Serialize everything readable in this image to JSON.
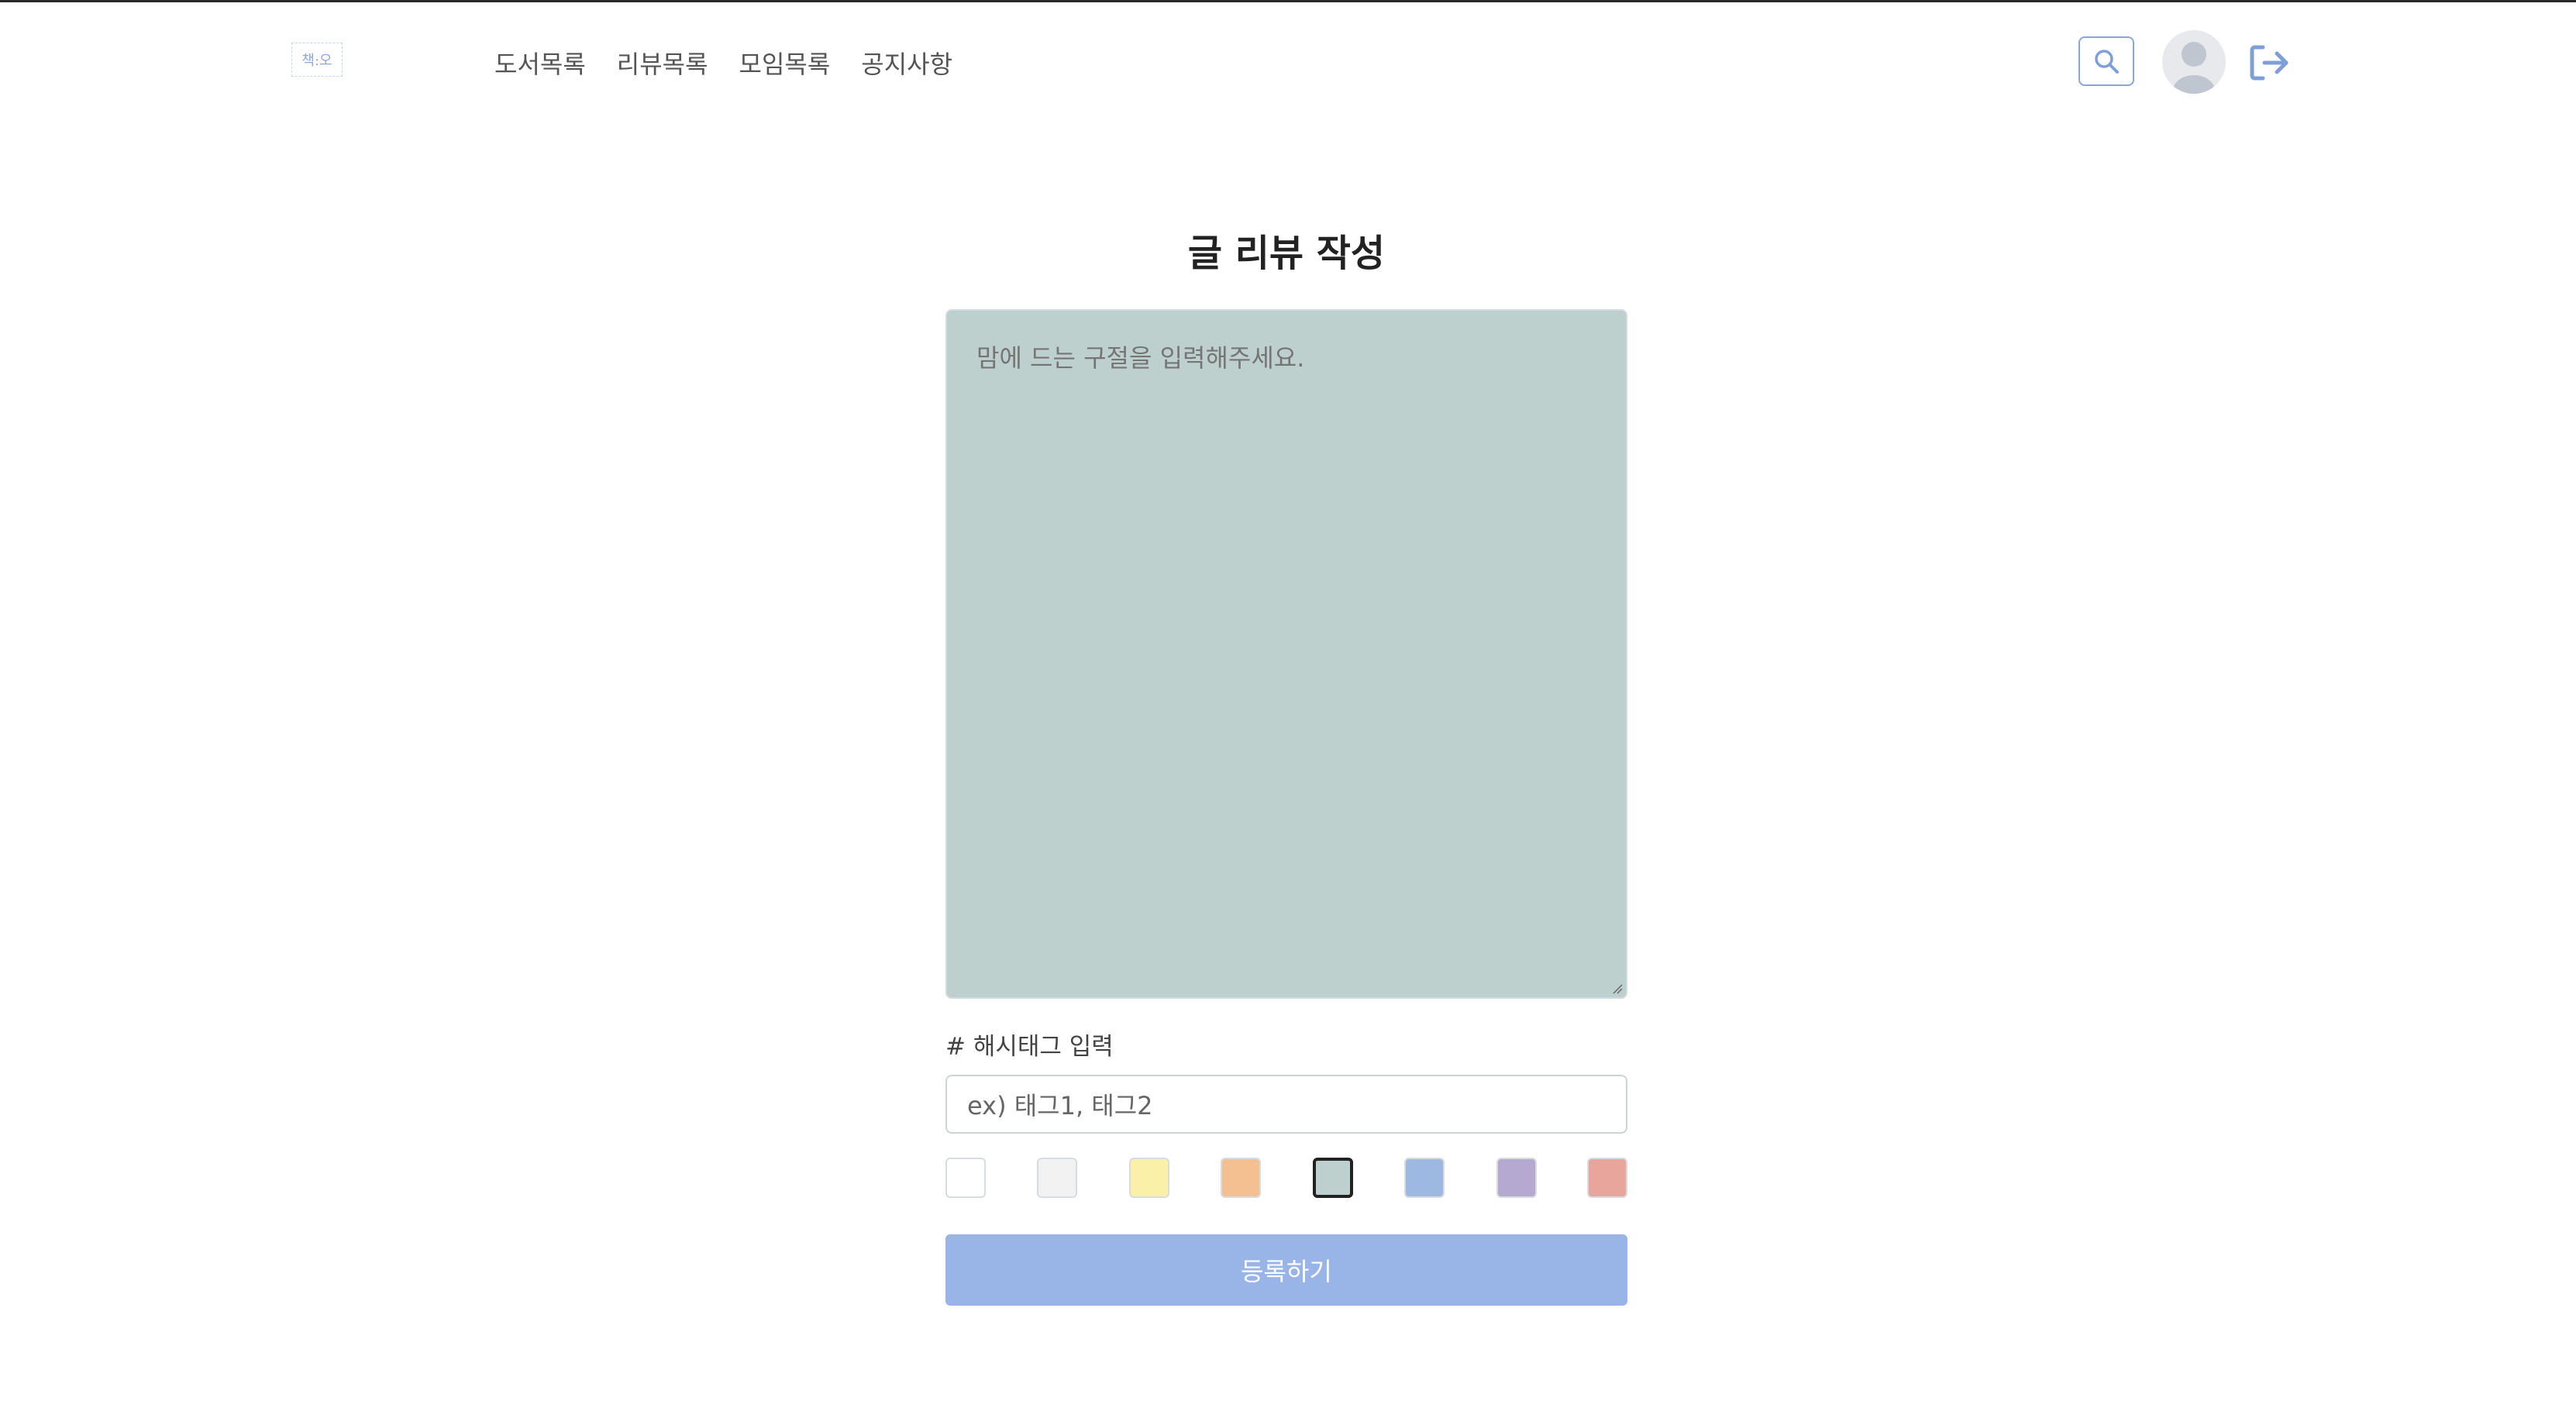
{
  "header": {
    "logo_text": "책:오",
    "nav": [
      "도서목록",
      "리뷰목록",
      "모임목록",
      "공지사항"
    ],
    "icons": {
      "search": "search-icon",
      "avatar": "user-avatar-icon",
      "logout": "logout-icon"
    },
    "accent_color": "#7f9fd9"
  },
  "main": {
    "title": "글 리뷰 작성",
    "quote_placeholder": "맘에 드는 구절을 입력해주세요.",
    "quote_value": "",
    "hashtag_label": "# 해시태그 입력",
    "hashtag_placeholder": "ex) 태그1, 태그2",
    "hashtag_value": "",
    "colors": [
      {
        "name": "white",
        "hex": "#ffffff",
        "selected": false
      },
      {
        "name": "light-gray",
        "hex": "#f2f2f2",
        "selected": false
      },
      {
        "name": "yellow",
        "hex": "#fbf0a8",
        "selected": false
      },
      {
        "name": "orange",
        "hex": "#f4c092",
        "selected": false
      },
      {
        "name": "sage",
        "hex": "#bdd0cd",
        "selected": true
      },
      {
        "name": "blue",
        "hex": "#9db9e2",
        "selected": false
      },
      {
        "name": "purple",
        "hex": "#b5a9d2",
        "selected": false
      },
      {
        "name": "pink",
        "hex": "#e8a59b",
        "selected": false
      }
    ],
    "submit_label": "등록하기",
    "submit_color": "#99b4e6"
  }
}
